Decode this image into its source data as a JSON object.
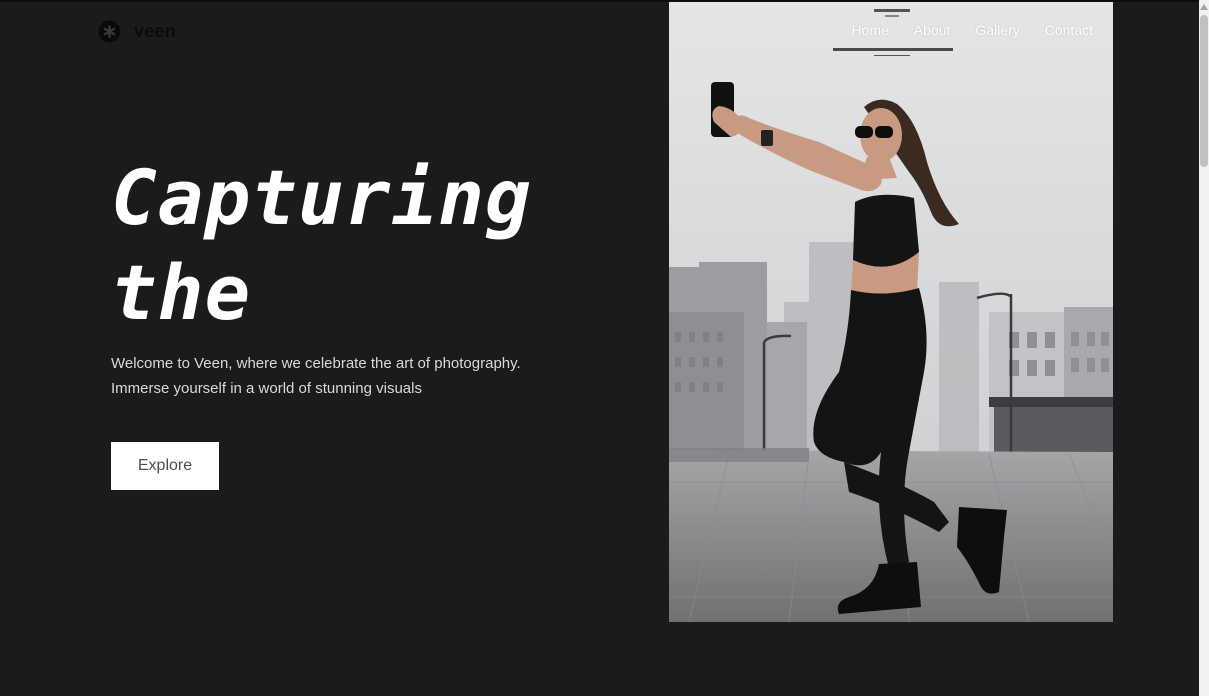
{
  "brand": {
    "name": "veen",
    "icon": "asterisk-logo-icon"
  },
  "nav": {
    "items": [
      {
        "label": "Home"
      },
      {
        "label": "About"
      },
      {
        "label": "Gallery"
      },
      {
        "label": "Contact"
      }
    ]
  },
  "hero": {
    "title_line1": "Capturing",
    "title_line2": "the",
    "subtitle_line1": "Welcome to Veen, where we celebrate the art of photography.",
    "subtitle_line2": "Immerse yourself in a world of stunning visuals",
    "cta_label": "Explore",
    "image_description": "woman-taking-selfie-foggy-city-photo"
  },
  "colors": {
    "background": "#1b1b1c",
    "button_bg": "#ffffff",
    "button_text": "#4e4e4e",
    "text_primary": "#ffffff",
    "text_secondary": "#d9d9d9"
  }
}
